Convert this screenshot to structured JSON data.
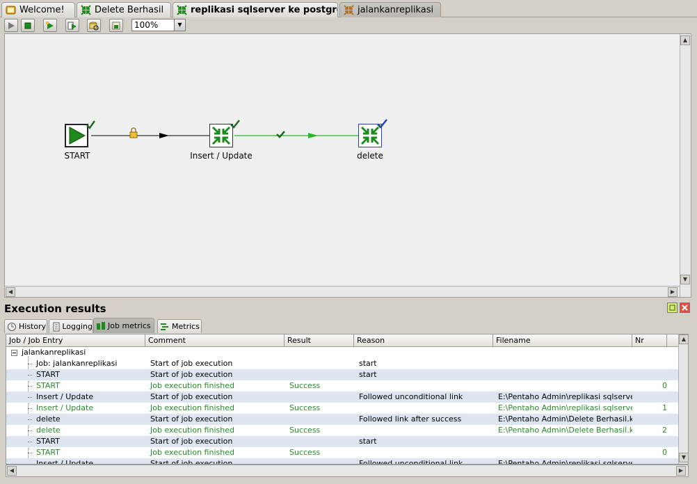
{
  "tabs": [
    {
      "label": "Welcome!",
      "icon": "spoon-welcome-icon",
      "bold": false,
      "active": false
    },
    {
      "label": "Delete Berhasil",
      "icon": "transformation-icon",
      "bold": false,
      "active": false
    },
    {
      "label": "replikasi sqlserver ke postgre",
      "icon": "transformation-icon",
      "bold": true,
      "active": false
    },
    {
      "label": "jalankanreplikasi",
      "icon": "job-icon",
      "bold": false,
      "active": true,
      "closable": true
    }
  ],
  "toolbar": {
    "buttons": [
      "run-icon",
      "stop-icon",
      "replay-icon",
      "preview-icon",
      "sql-icon",
      "impact-icon"
    ],
    "zoom": "100%"
  },
  "canvas": {
    "nodes": [
      {
        "label": "START",
        "icon": "start-play-icon",
        "status": "success"
      },
      {
        "label": "Insert / Update",
        "icon": "transformation-icon",
        "status": "success"
      },
      {
        "label": "delete",
        "icon": "transformation-icon",
        "status": "running"
      }
    ],
    "colors": {
      "hop_default": "#000000",
      "hop_success": "#2ab82a",
      "node_green": "#1e8a1e"
    }
  },
  "results": {
    "title": "Execution results",
    "tabs": [
      {
        "label": "History",
        "icon": "history-icon"
      },
      {
        "label": "Logging",
        "icon": "logging-icon"
      },
      {
        "label": "Job metrics",
        "icon": "job-metrics-icon",
        "active": true
      },
      {
        "label": "Metrics",
        "icon": "metrics-icon"
      }
    ],
    "columns": [
      "Job / Job Entry",
      "Comment",
      "Result",
      "Reason",
      "Filename",
      "Nr"
    ],
    "root": "jalankanreplikasi",
    "rows": [
      {
        "entry": "Job: jalankanreplikasi",
        "comment": "Start of job execution",
        "result": "",
        "reason": "start",
        "filename": "",
        "nr": "",
        "green": false
      },
      {
        "entry": "START",
        "comment": "Start of job execution",
        "result": "",
        "reason": "start",
        "filename": "",
        "nr": "",
        "green": false
      },
      {
        "entry": "START",
        "comment": "Job execution finished",
        "result": "Success",
        "reason": "",
        "filename": "",
        "nr": "0",
        "green": true
      },
      {
        "entry": "Insert / Update",
        "comment": "Start of job execution",
        "result": "",
        "reason": "Followed unconditional link",
        "filename": "E:\\Pentaho Admin\\replikasi sqlserver ...",
        "nr": "",
        "green": false
      },
      {
        "entry": "Insert / Update",
        "comment": "Job execution finished",
        "result": "Success",
        "reason": "",
        "filename": "E:\\Pentaho Admin\\replikasi sqlserver ...",
        "nr": "1",
        "green": true
      },
      {
        "entry": "delete",
        "comment": "Start of job execution",
        "result": "",
        "reason": "Followed link after success",
        "filename": "E:\\Pentaho Admin\\Delete Berhasil.ktr",
        "nr": "",
        "green": false
      },
      {
        "entry": "delete",
        "comment": "Job execution finished",
        "result": "Success",
        "reason": "",
        "filename": "E:\\Pentaho Admin\\Delete Berhasil.ktr",
        "nr": "2",
        "green": true
      },
      {
        "entry": "START",
        "comment": "Start of job execution",
        "result": "",
        "reason": "start",
        "filename": "",
        "nr": "",
        "green": false
      },
      {
        "entry": "START",
        "comment": "Job execution finished",
        "result": "Success",
        "reason": "",
        "filename": "",
        "nr": "0",
        "green": true
      },
      {
        "entry": "Insert / Update",
        "comment": "Start of job execution",
        "result": "",
        "reason": "Followed unconditional link",
        "filename": "E:\\Pentaho Admin\\replikasi sqlserver ...",
        "nr": "",
        "green": false
      }
    ]
  }
}
